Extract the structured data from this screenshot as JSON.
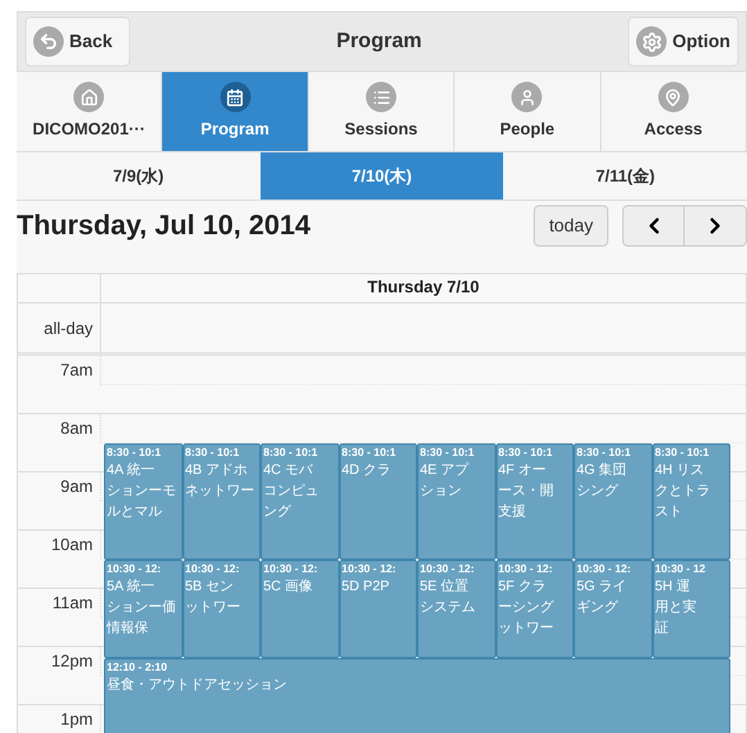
{
  "header": {
    "back": "Back",
    "title": "Program",
    "option": "Option"
  },
  "nav": [
    {
      "label": "DICOMO201···",
      "selected": false
    },
    {
      "label": "Program",
      "selected": true
    },
    {
      "label": "Sessions",
      "selected": false
    },
    {
      "label": "People",
      "selected": false
    },
    {
      "label": "Access",
      "selected": false
    }
  ],
  "days": [
    {
      "label": "7/9(水)",
      "selected": false
    },
    {
      "label": "7/10(木)",
      "selected": true
    },
    {
      "label": "7/11(金)",
      "selected": false
    }
  ],
  "calendar": {
    "title": "Thursday, Jul 10, 2014",
    "today": "today",
    "column": "Thursday 7/10",
    "allday": "all-day",
    "hours": [
      "7am",
      "8am",
      "9am",
      "10am",
      "11am",
      "12pm",
      "1pm"
    ],
    "events": [
      {
        "time": "8:30 - 10:1",
        "lines": [
          "4A 統一",
          "ションーモ",
          "ルとマル"
        ]
      },
      {
        "time": "8:30 - 10:1",
        "lines": [
          "4B アドホ",
          "ネットワー"
        ]
      },
      {
        "time": "8:30 - 10:1",
        "lines": [
          "4C モバ",
          "コンピュ",
          "ング"
        ]
      },
      {
        "time": "8:30 - 10:1",
        "lines": [
          "4D クラ"
        ]
      },
      {
        "time": "8:30 - 10:1",
        "lines": [
          "4E アプ",
          "ション"
        ]
      },
      {
        "time": "8:30 - 10:1",
        "lines": [
          "4F オー",
          "ース・開",
          "支援"
        ]
      },
      {
        "time": "8:30 - 10:1",
        "lines": [
          "4G 集団",
          "シング"
        ]
      },
      {
        "time": "8:30 - 10:1",
        "lines": [
          "4H リス",
          "クとトラ",
          "スト"
        ]
      },
      {
        "time": "10:30 - 12:",
        "lines": [
          "5A 統一",
          "ションー価",
          "情報保"
        ]
      },
      {
        "time": "10:30 - 12:",
        "lines": [
          "5B セン",
          "ットワー"
        ]
      },
      {
        "time": "10:30 - 12:",
        "lines": [
          "5C 画像"
        ]
      },
      {
        "time": "10:30 - 12:",
        "lines": [
          "5D P2P"
        ]
      },
      {
        "time": "10:30 - 12:",
        "lines": [
          "5E 位置",
          "システム"
        ]
      },
      {
        "time": "10:30 - 12:",
        "lines": [
          "5F クラ",
          "ーシング",
          "ットワー"
        ]
      },
      {
        "time": "10:30 - 12:",
        "lines": [
          "5G ライ",
          "ギング"
        ]
      },
      {
        "time": "10:30 - 12",
        "lines": [
          "5H 運",
          "用と実",
          "証"
        ]
      },
      {
        "time": "12:10 - 2:10",
        "lines": [
          "昼食・アウトドアセッション"
        ]
      }
    ]
  }
}
